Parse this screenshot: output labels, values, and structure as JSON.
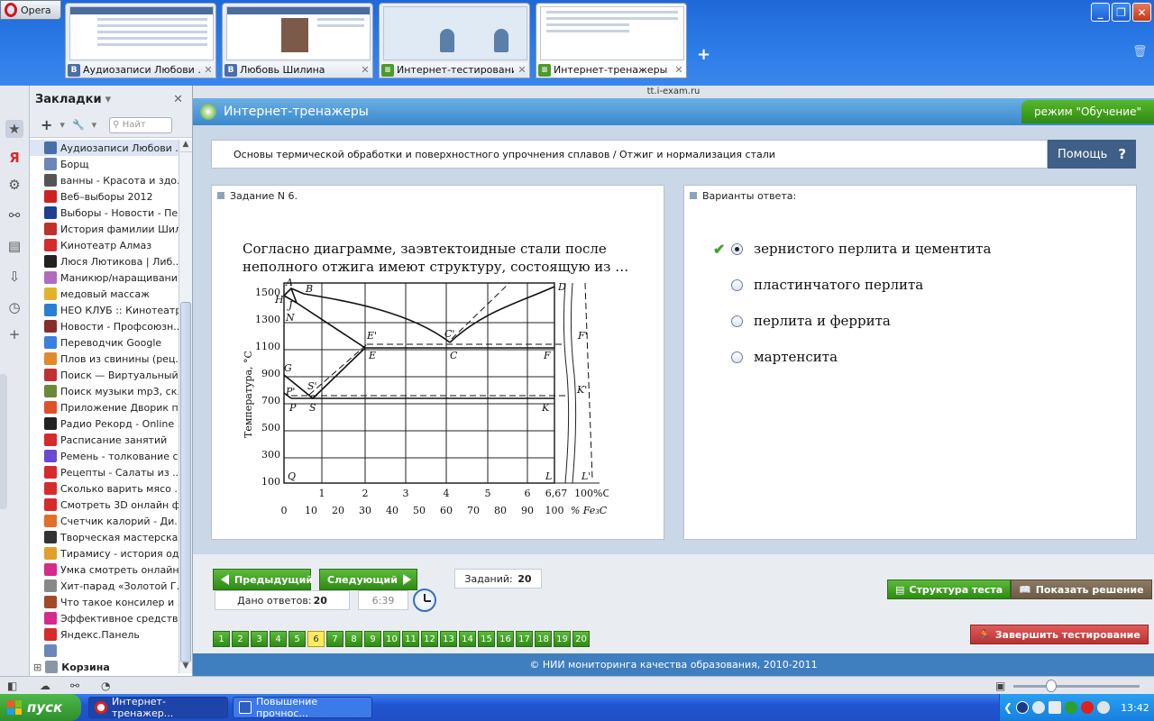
{
  "browser": {
    "menu_label": "Opera",
    "url": "tt.i-exam.ru",
    "tabs": [
      {
        "label": "Аудиозаписи Любови ..."
      },
      {
        "label": "Любовь Шилина"
      },
      {
        "label": "Интернет-тестирование"
      },
      {
        "label": "Интернет-тренажеры"
      }
    ],
    "new_tab": "+"
  },
  "sidebar": {
    "title": "Закладки",
    "search_placeholder": "Найт",
    "bookmarks": [
      {
        "label": "Аудиозаписи Любови ...",
        "color": "#4a6ea8"
      },
      {
        "label": "Борщ",
        "color": "#6b86b8"
      },
      {
        "label": "ванны - Красота и здо...",
        "color": "#555555"
      },
      {
        "label": "Веб–выборы 2012",
        "color": "#cc2222"
      },
      {
        "label": "Выборы - Новости - Пе...",
        "color": "#1e3f8f"
      },
      {
        "label": "История фамилии Шил...",
        "color": "#c0302a"
      },
      {
        "label": "Кинотеатр Алмаз",
        "color": "#d62b2b"
      },
      {
        "label": "Люся Лютикова | Либ...",
        "color": "#222222"
      },
      {
        "label": "Маникюр/наращивани...",
        "color": "#b06ac0"
      },
      {
        "label": "медовый массаж",
        "color": "#e2b22c"
      },
      {
        "label": "НЕО КЛУБ :: Кинотеатр",
        "color": "#2b7fd0"
      },
      {
        "label": "Новости - Профсоюзн...",
        "color": "#8a2b2b"
      },
      {
        "label": "Переводчик Google",
        "color": "#3b7fe0"
      },
      {
        "label": "Плов из свинины (рец...",
        "color": "#e08a2a"
      },
      {
        "label": "Поиск — Виртуальный...",
        "color": "#c03030"
      },
      {
        "label": "Поиск музыки mp3, ск...",
        "color": "#6a8a3a"
      },
      {
        "label": "Приложение Дворик п...",
        "color": "#e0502a"
      },
      {
        "label": "Радио Рекорд - Online ...",
        "color": "#222222"
      },
      {
        "label": "Расписание занятий",
        "color": "#d62b2b"
      },
      {
        "label": "Ремень - толкование с...",
        "color": "#6a4ad0"
      },
      {
        "label": "Рецепты - Салаты из ...",
        "color": "#d62b2b"
      },
      {
        "label": "Сколько варить мясо ...",
        "color": "#d62b2b"
      },
      {
        "label": "Смотреть 3D онлайн ф...",
        "color": "#d62b2b"
      },
      {
        "label": "Счетчик калорий - Ди...",
        "color": "#e0702a"
      },
      {
        "label": "Творческая мастерска...",
        "color": "#333333"
      },
      {
        "label": "Тирамису - история од...",
        "color": "#e0a02a"
      },
      {
        "label": "Умка смотреть онлайн...",
        "color": "#d62b8a"
      },
      {
        "label": "Хит-парад «Золотой Г...",
        "color": "#888888"
      },
      {
        "label": "Что такое консилер и ...",
        "color": "#a04a2a"
      },
      {
        "label": "Эффективное средств...",
        "color": "#d62b8a"
      },
      {
        "label": "Яндекс.Панель",
        "color": "#d62b2b"
      },
      {
        "label": "",
        "color": "#6b86b8"
      }
    ],
    "folder": "Корзина"
  },
  "app": {
    "title": "Интернет-тренажеры",
    "mode": "режим \"Обучение\"",
    "breadcrumb": "Основы термической обработки и поверхностного упрочнения сплавов / Отжиг и нормализация стали",
    "help": "Помощь",
    "task_header": "Задание N 6.",
    "question": "Согласно диаграмме, заэвтектоидные стали после неполного отжига имеют структуру, состоящую из …",
    "answers_header": "Варианты ответа:",
    "answers": [
      {
        "label": "зернистого перлита и цементита",
        "selected": true,
        "correct": true
      },
      {
        "label": "пластинчатого перлита",
        "selected": false,
        "correct": false
      },
      {
        "label": "перлита и феррита",
        "selected": false,
        "correct": false
      },
      {
        "label": "мартенсита",
        "selected": false,
        "correct": false
      }
    ],
    "prev": "Предыдущий",
    "next": "Следующий",
    "tasks_label": "Заданий:",
    "tasks_count": "20",
    "answered_label": "Дано ответов:",
    "answered_count": "20",
    "timer": "6:39",
    "structure_btn": "Структура теста",
    "solution_btn": "Показать решение",
    "finish_btn": "Завершить тестирование",
    "current_question": 6,
    "question_numbers": [
      "1",
      "2",
      "3",
      "4",
      "5",
      "6",
      "7",
      "8",
      "9",
      "10",
      "11",
      "12",
      "13",
      "14",
      "15",
      "16",
      "17",
      "18",
      "19",
      "20"
    ],
    "footer": "© НИИ мониторинга качества образования, 2010-2011"
  },
  "diagram": {
    "ylabel": "Температура, °С",
    "yticks": [
      "1500",
      "1300",
      "1100",
      "900",
      "700",
      "500",
      "300",
      "100"
    ],
    "xticks_top": [
      "1",
      "2",
      "3",
      "4",
      "5",
      "6",
      "6,67",
      "100%C"
    ],
    "xticks_bottom": [
      "0",
      "10",
      "20",
      "30",
      "40",
      "50",
      "60",
      "70",
      "80",
      "90",
      "100"
    ],
    "xunit": "% Fe₃C",
    "points": [
      "A",
      "B",
      "H",
      "J",
      "N",
      "E'",
      "E",
      "C'",
      "C",
      "D",
      "F'",
      "F",
      "G",
      "P'",
      "S'",
      "P",
      "S",
      "K'",
      "K",
      "Q",
      "L",
      "L'"
    ]
  },
  "taskbar": {
    "start": "пуск",
    "tasks": [
      {
        "label": "Интернет-тренажер...",
        "active": true
      },
      {
        "label": "Повышение прочнос...",
        "active": false
      }
    ],
    "clock": "13:42"
  }
}
